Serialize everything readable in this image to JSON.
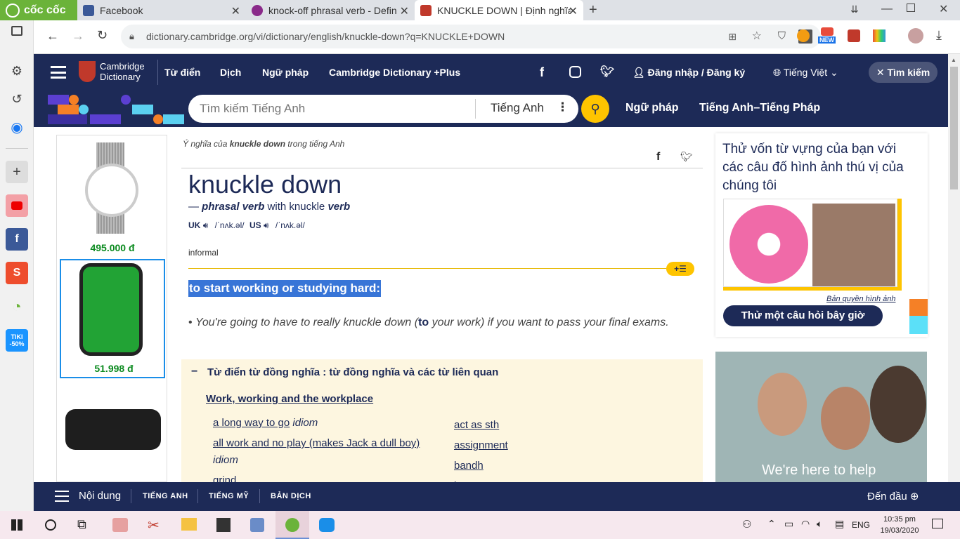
{
  "tabs": [
    {
      "label": "cốc cốc"
    },
    {
      "label": "Facebook"
    },
    {
      "label": "knock-off phrasal verb - Defin"
    },
    {
      "label": "KNUCKLE DOWN | Định nghĩa"
    }
  ],
  "address": {
    "url": "dictionary.cambridge.org/vi/dictionary/english/knuckle-down?q=KNUCKLE+DOWN",
    "new_badge": "NEW"
  },
  "header": {
    "logo_line1": "Cambridge",
    "logo_line2": "Dictionary",
    "nav": [
      "Từ điển",
      "Dịch",
      "Ngữ pháp",
      "Cambridge Dictionary +Plus"
    ],
    "login": "Đăng nhập / Đăng ký",
    "language": "Tiếng Việt",
    "search_toggle": "Tìm kiếm"
  },
  "searchbar": {
    "placeholder": "Tìm kiếm Tiếng Anh",
    "dict": "Tiếng Anh",
    "links": [
      "Ngữ pháp",
      "Tiếng Anh–Tiếng Pháp"
    ]
  },
  "ads": {
    "prices": [
      "495.000 đ",
      "51.998 đ"
    ]
  },
  "entry": {
    "breadcrumb_pre": "Ý nghĩa của ",
    "breadcrumb_word": "knuckle down",
    "breadcrumb_post": " trong tiếng Anh",
    "headword": "knuckle down",
    "pos_dash": "— ",
    "pos": "phrasal verb",
    "with": " with knuckle ",
    "with_pos": "verb",
    "uk": "UK",
    "uk_ipa": "/ˈnʌk.əl/",
    "us": "US",
    "us_ipa": "/ˈnʌk.əl/",
    "register": "informal",
    "definition": "to start working or studying hard:",
    "example_pre": "You're going to have to really knuckle down (",
    "example_bold": "to",
    "example_post": " your work) if you want to pass your final exams.",
    "thesaurus_title": "Từ điển từ đồng nghĩa : từ đồng nghĩa và các từ liên quan",
    "thesaurus_topic": "Work, working and the workplace",
    "thes_left": [
      {
        "text": "a long way to go",
        "tag": "idiom"
      },
      {
        "text": "all work and no play (makes Jack a dull boy)",
        "tag": "idiom"
      },
      {
        "text": "grind",
        "tag": ""
      }
    ],
    "thes_right": [
      "act as sth",
      "assignment",
      "bandh",
      "beep"
    ]
  },
  "quiz": {
    "text": "Thử vốn từ vựng của bạn với các câu đố hình ảnh thú vị của chúng tôi",
    "copyright": "Bản quyền hình ảnh",
    "button": "Thử một câu hỏi bây giờ",
    "banner": "We're here to help"
  },
  "bottombar": {
    "menu": "Nội dung",
    "links": [
      "TIẾNG ANH",
      "TIẾNG MỸ",
      "BẢN DỊCH"
    ],
    "top": "Đến đầu"
  },
  "taskbar": {
    "lang": "ENG",
    "time": "10:35 pm",
    "date": "19/03/2020"
  },
  "sidebar": {
    "tiki": "TIKI",
    "tiki_off": "-50%"
  }
}
